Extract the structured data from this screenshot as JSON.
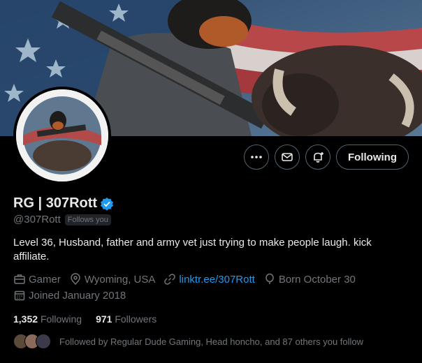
{
  "profile": {
    "display_name": "RG | 307Rott",
    "handle": "@307Rott",
    "follows_you": "Follows you",
    "bio": "Level 36, Husband, father and army vet just trying to make people laugh. kick affiliate.",
    "category": "Gamer",
    "location": "Wyoming, USA",
    "link": "linktr.ee/307Rott",
    "born": "Born October 30",
    "joined": "Joined January 2018",
    "following_count": "1,352",
    "following_label": "Following",
    "followers_count": "971",
    "followers_label": "Followers",
    "followed_by": "Followed by Regular Dude Gaming, Head honcho, and 87 others you follow"
  },
  "actions": {
    "following_button": "Following"
  },
  "icons": {
    "more": "more-icon",
    "message": "message-icon",
    "notify": "notification-bell-icon",
    "verified": "verified-badge-icon",
    "category": "briefcase-icon",
    "location": "location-pin-icon",
    "link": "link-icon",
    "born": "balloon-icon",
    "joined": "calendar-icon"
  },
  "colors": {
    "background": "#000000",
    "text_primary": "#e7e9ea",
    "text_secondary": "#71767b",
    "accent": "#1d9bf0",
    "border": "#536471"
  }
}
